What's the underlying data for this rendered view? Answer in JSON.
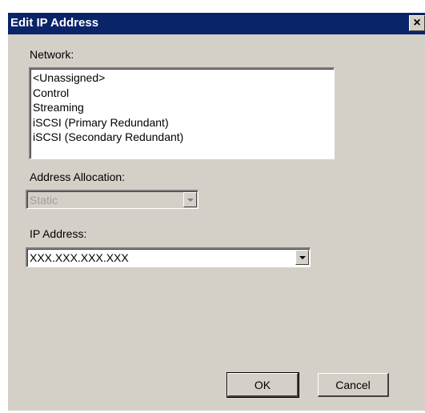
{
  "dialog": {
    "title": "Edit IP Address",
    "close_glyph": "×"
  },
  "network": {
    "label": "Network:",
    "items": [
      "<Unassigned>",
      "Control",
      "Streaming",
      "iSCSI (Primary Redundant)",
      "iSCSI (Secondary Redundant)"
    ]
  },
  "address_allocation": {
    "label": "Address Allocation:",
    "value": "Static",
    "enabled": false
  },
  "ip_address": {
    "label": "IP Address:",
    "value": "XXX.XXX.XXX.XXX"
  },
  "buttons": {
    "ok_label": "OK",
    "cancel_label": "Cancel"
  }
}
